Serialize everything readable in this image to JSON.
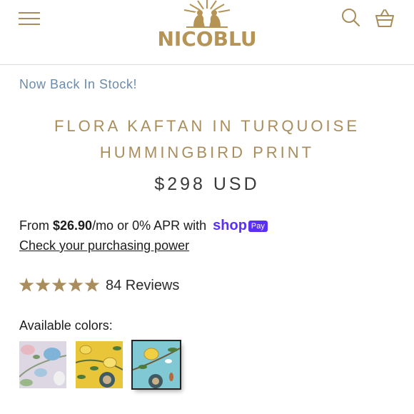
{
  "header": {
    "logo_text": "NICOBLU",
    "menu_icon": "hamburger-menu-icon",
    "search_icon": "search-icon",
    "cart_icon": "shopping-basket-icon"
  },
  "product": {
    "stock_status": "Now Back In Stock!",
    "title_line1": "FLORA KAFTAN IN TURQUOISE",
    "title_line2": "HUMMINGBIRD PRINT",
    "price": "$298 USD"
  },
  "financing": {
    "prefix": "From ",
    "amount": "$26.90",
    "suffix": "/mo or 0% APR with",
    "provider": "shop",
    "provider_badge": "Pay",
    "check_link": "Check your purchasing power"
  },
  "rating": {
    "stars": 5,
    "reviews_label": "84 Reviews"
  },
  "colors": {
    "label": "Available colors:",
    "swatches": [
      {
        "name": "lavender-floral",
        "selected": false
      },
      {
        "name": "yellow-lemon",
        "selected": false
      },
      {
        "name": "turquoise-hummingbird",
        "selected": true
      }
    ]
  },
  "theme": {
    "gold": "#a98d5c",
    "stock_blue": "#6c8bac",
    "shop_purple": "#5a31f4"
  }
}
